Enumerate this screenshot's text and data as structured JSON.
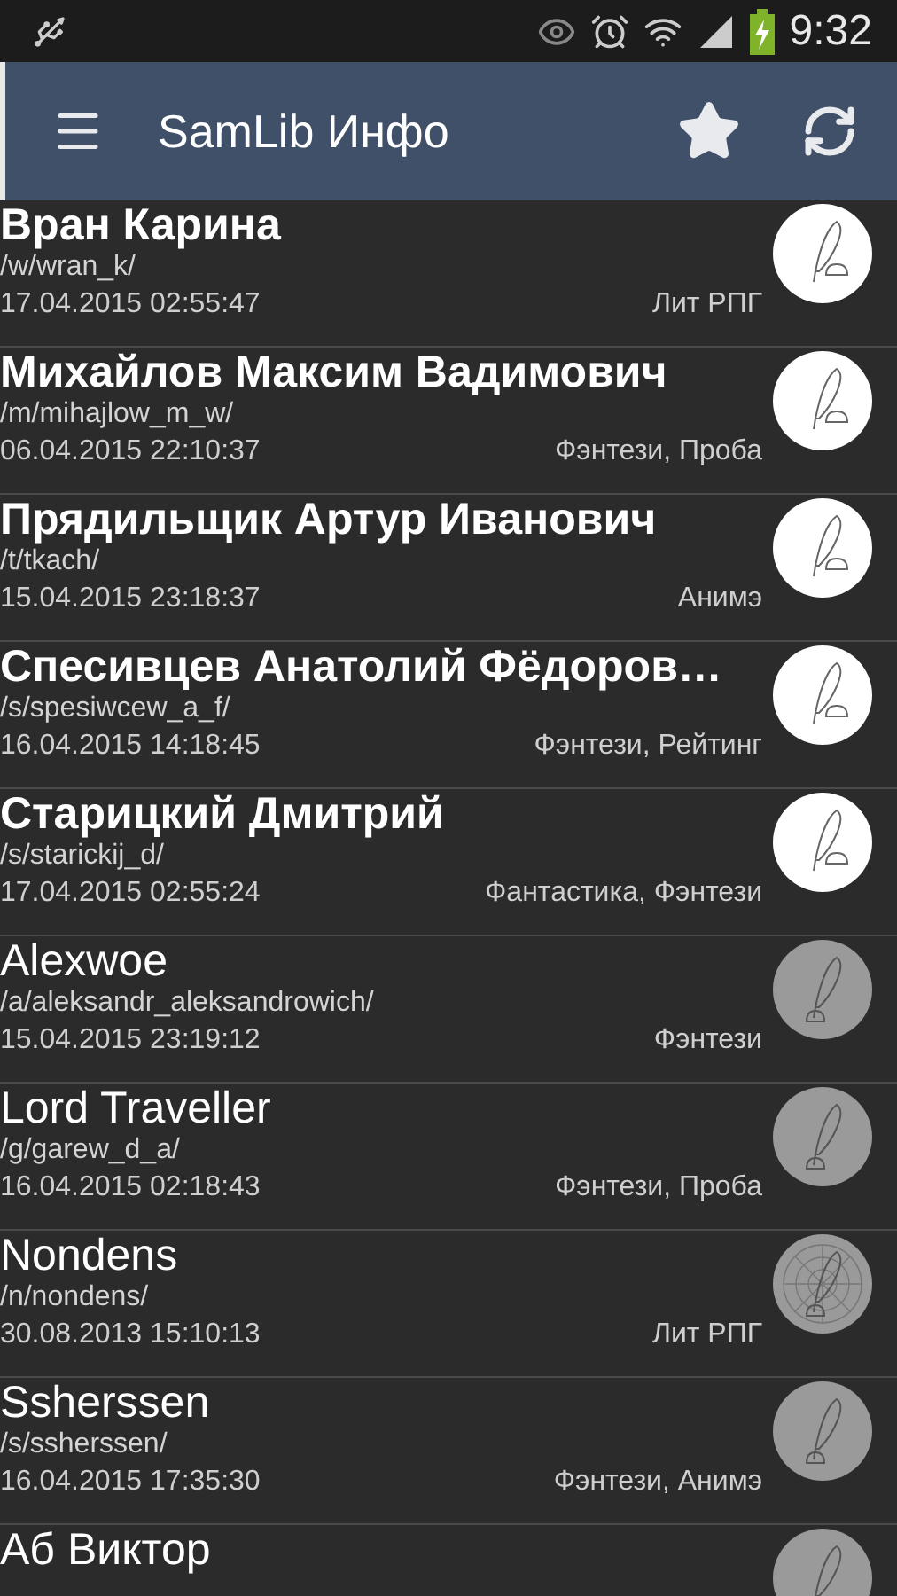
{
  "status_bar": {
    "time": "9:32"
  },
  "app_bar": {
    "title": "SamLib Инфо"
  },
  "authors": [
    {
      "name": "Вран Карина",
      "path": "/w/wran_k/",
      "date": "17.04.2015 02:55:47",
      "genres": "Лит РПГ",
      "updated": true,
      "kind": "quill"
    },
    {
      "name": "Михайлов Максим Вадимович",
      "path": "/m/mihajlow_m_w/",
      "date": "06.04.2015 22:10:37",
      "genres": "Фэнтези, Проба",
      "updated": true,
      "kind": "quill"
    },
    {
      "name": "Прядильщик Артур Иванович",
      "path": "/t/tkach/",
      "date": "15.04.2015 23:18:37",
      "genres": "Анимэ",
      "updated": true,
      "kind": "quill"
    },
    {
      "name": "Спесивцев Анатолий Фёдоров…",
      "path": "/s/spesiwcew_a_f/",
      "date": "16.04.2015 14:18:45",
      "genres": "Фэнтези, Рейтинг",
      "updated": true,
      "kind": "quill"
    },
    {
      "name": "Старицкий Дмитрий",
      "path": "/s/starickij_d/",
      "date": "17.04.2015 02:55:24",
      "genres": "Фантастика, Фэнтези",
      "updated": true,
      "kind": "quill"
    },
    {
      "name": "Alexwoe",
      "path": "/a/aleksandr_aleksandrowich/",
      "date": "15.04.2015 23:19:12",
      "genres": "Фэнтези",
      "updated": false,
      "kind": "quill"
    },
    {
      "name": "Lord Traveller",
      "path": "/g/garew_d_a/",
      "date": "16.04.2015 02:18:43",
      "genres": "Фэнтези, Проба",
      "updated": false,
      "kind": "quill"
    },
    {
      "name": "Nondens",
      "path": "/n/nondens/",
      "date": "30.08.2013 15:10:13",
      "genres": "Лит РПГ",
      "updated": false,
      "kind": "cobweb"
    },
    {
      "name": "Ssherssen",
      "path": "/s/ssherssen/",
      "date": "16.04.2015 17:35:30",
      "genres": "Фэнтези, Анимэ",
      "updated": false,
      "kind": "quill"
    },
    {
      "name": "Аб Виктор",
      "updated": false,
      "kind": "quill"
    }
  ]
}
